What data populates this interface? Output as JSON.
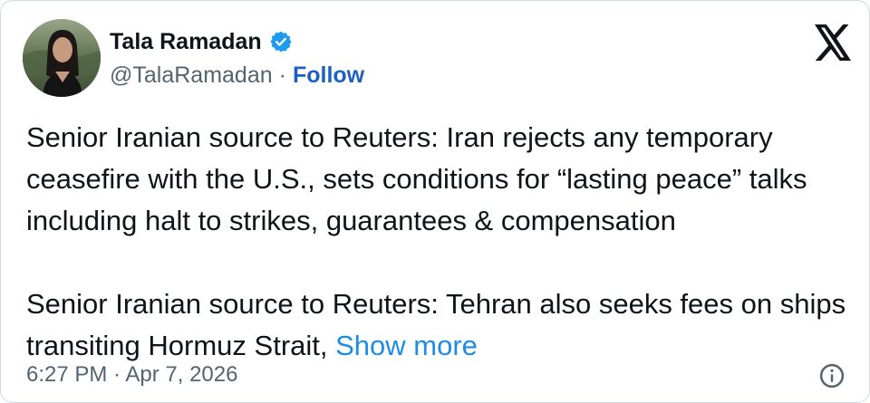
{
  "author": {
    "name": "Tala Ramadan",
    "handle": "@TalaRamadan",
    "separator": "·",
    "follow_label": "Follow",
    "verified_icon": "verified-badge-icon",
    "verified_color": "#1d9bf0"
  },
  "brand": {
    "logo_icon": "x-logo-icon"
  },
  "tweet": {
    "paragraph_1": "Senior Iranian source to Reuters: Iran rejects any temporary ceasefire with the U.S., sets conditions for “lasting peace” talks including halt to strikes, guarantees & compensation",
    "paragraph_2": "Senior Iranian source to Reuters: Tehran also seeks fees on ships transiting Hormuz Strait,",
    "show_more_label": "Show more"
  },
  "footer": {
    "timestamp": "6:27 PM · Apr 7, 2026",
    "info_icon": "info-icon"
  },
  "colors": {
    "text": "#0f1419",
    "secondary": "#536471",
    "link": "#1d8ce8",
    "follow": "#1d60c2"
  }
}
